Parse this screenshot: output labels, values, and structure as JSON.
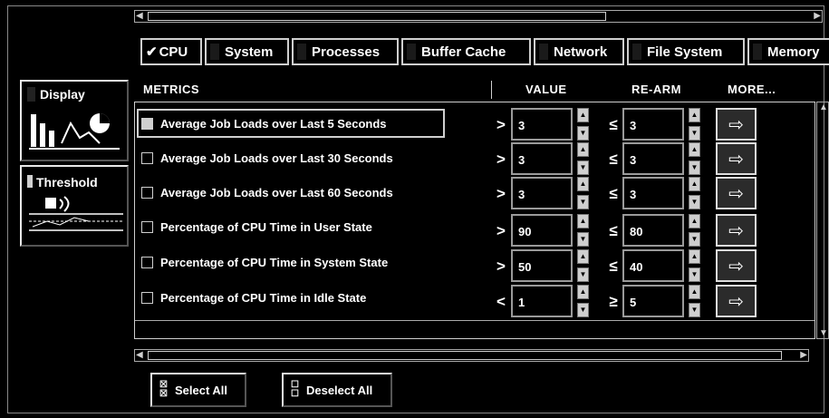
{
  "tabs": [
    {
      "label": "CPU",
      "active": true,
      "checked": true
    },
    {
      "label": "System",
      "active": false
    },
    {
      "label": "Processes",
      "active": false
    },
    {
      "label": "Buffer Cache",
      "active": false
    },
    {
      "label": "Network",
      "active": false
    },
    {
      "label": "File System",
      "active": false
    },
    {
      "label": "Memory",
      "active": false
    }
  ],
  "sidebar": {
    "display_label": "Display",
    "threshold_label": "Threshold"
  },
  "headers": {
    "metrics": "METRICS",
    "value": "VALUE",
    "rearm": "RE-ARM",
    "more": "MORE..."
  },
  "rows": [
    {
      "label": "Average Job Loads over Last 5 Seconds",
      "checked": true,
      "op": ">",
      "value": "3",
      "rearm_op": "≤",
      "rearm": "3"
    },
    {
      "label": "Average Job Loads over Last 30 Seconds",
      "checked": false,
      "op": ">",
      "value": "3",
      "rearm_op": "≤",
      "rearm": "3"
    },
    {
      "label": "Average Job Loads over Last 60 Seconds",
      "checked": false,
      "op": ">",
      "value": "3",
      "rearm_op": "≤",
      "rearm": "3"
    },
    {
      "label": "Percentage of CPU Time in User State",
      "checked": false,
      "op": ">",
      "value": "90",
      "rearm_op": "≤",
      "rearm": "80"
    },
    {
      "label": "Percentage of CPU Time in System State",
      "checked": false,
      "op": ">",
      "value": "50",
      "rearm_op": "≤",
      "rearm": "40"
    },
    {
      "label": "Percentage of CPU Time in Idle State",
      "checked": false,
      "op": "<",
      "value": "1",
      "rearm_op": "≥",
      "rearm": "5"
    }
  ],
  "footer": {
    "select_all": "Select All",
    "deselect_all": "Deselect All"
  },
  "icons": {
    "more": "right-arrow-icon",
    "spin_up": "spin-up-icon",
    "spin_down": "spin-down-icon"
  }
}
